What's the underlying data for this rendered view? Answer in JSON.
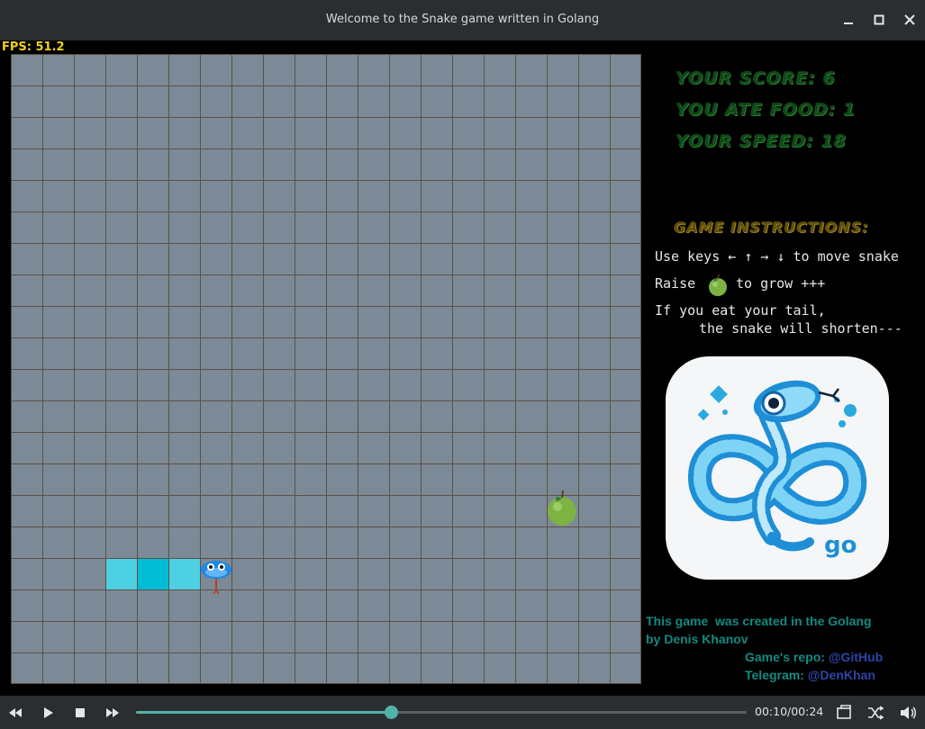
{
  "window": {
    "title": "Welcome to the Snake game written in Golang"
  },
  "hud": {
    "fps": "FPS: 51.2"
  },
  "stats": {
    "score": "YOUR SCORE: 6",
    "food": "YOU ATE FOOD: 1",
    "speed": "YOUR SPEED: 18"
  },
  "instructions": {
    "title": "GAME INSTRUCTIONS:",
    "line1": "Use keys ← ↑ → ↓ to move snake",
    "line2_prefix": "Raise",
    "line2_suffix": "to grow +++",
    "line3": "If you eat your tail,",
    "line4": "the snake will shorten---"
  },
  "logo": {
    "text": "go"
  },
  "credits": {
    "line1": "This game  was created in the Golang",
    "line2": "by Denis Khanov",
    "repo_label": "Game's repo: ",
    "repo_link": "@GitHub",
    "telegram_label": "Telegram: ",
    "telegram_link": "@DenKhan"
  },
  "board": {
    "columns": 20,
    "rows": 20,
    "snake_body_cells": [
      [
        3,
        16
      ],
      [
        4,
        16
      ],
      [
        5,
        16
      ]
    ],
    "snake_head_cell": [
      6,
      16
    ],
    "food_cell": [
      17,
      14
    ]
  },
  "player": {
    "time": "00:10/00:24",
    "progress": 0.4167
  },
  "colors": {
    "board": "#7b8a96",
    "grid": "#5d5046",
    "snake_body": "#4dd0e1",
    "snake_body_alt": "#00bcd4",
    "apple": "#7cb342",
    "score_text": "#2e7d32",
    "instruction_title": "#b89a1e",
    "credits": "#138a80",
    "links": "#2d45a8",
    "fps": "#f2d11a",
    "accent": "#4fb3a8"
  }
}
